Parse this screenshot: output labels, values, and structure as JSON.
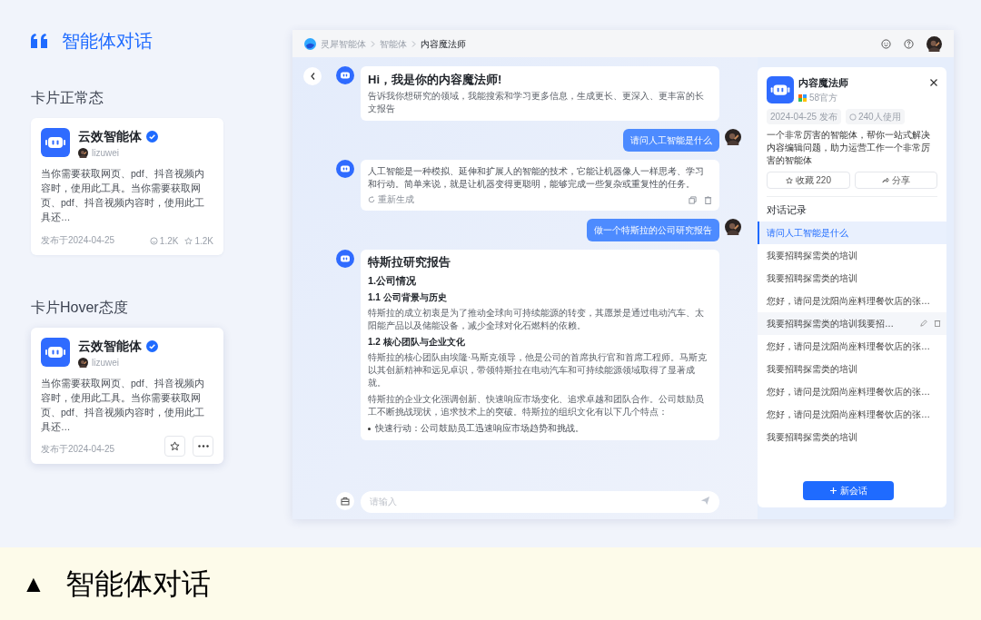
{
  "header": {
    "title": "智能体对话"
  },
  "sections": [
    {
      "heading": "卡片正常态",
      "hover": false,
      "card": {
        "name": "云效智能体",
        "verified": true,
        "author": "lizuwei",
        "description": "当你需要获取网页、pdf、抖音视频内容时，使用此工具。当你需要获取网页、pdf、抖音视频内容时，使用此工具还…",
        "date": "发布于2024-04-25",
        "comments": "1.2K",
        "stars": "1.2K"
      }
    },
    {
      "heading": "卡片Hover态度",
      "hover": true,
      "card": {
        "name": "云效智能体",
        "verified": true,
        "author": "lizuwei",
        "description": "当你需要获取网页、pdf、抖音视频内容时，使用此工具。当你需要获取网页、pdf、抖音视频内容时，使用此工具还…",
        "date": "发布于2024-04-25"
      }
    }
  ],
  "app": {
    "breadcrumb": [
      {
        "label": "灵犀智能体",
        "current": false
      },
      {
        "label": "智能体",
        "current": false
      },
      {
        "label": "内容魔法师",
        "current": true
      }
    ],
    "messages": [
      {
        "kind": "greeting",
        "title": "Hi，我是你的内容魔法师!",
        "text": "告诉我你想研究的领域，我能搜索和学习更多信息，生成更长、更深入、更丰富的长文报告"
      },
      {
        "kind": "user",
        "text": "请问人工智能是什么"
      },
      {
        "kind": "answer",
        "text": "人工智能是一种模拟、延伸和扩展人的智能的技术，它能让机器像人一样思考、学习和行动。简单来说，就是让机器变得更聪明，能够完成一些复杂或重复性的任务。",
        "action": "重新生成"
      },
      {
        "kind": "user",
        "text": "做一个特斯拉的公司研究报告"
      },
      {
        "kind": "report",
        "blocks": [
          {
            "kind": "h1",
            "text": "特斯拉研究报告"
          },
          {
            "kind": "h2",
            "text": "1.公司情况"
          },
          {
            "kind": "h3",
            "text": "1.1 公司背景与历史"
          },
          {
            "kind": "p",
            "text": "特斯拉的成立初衷是为了推动全球向可持续能源的转变，其愿景是通过电动汽车、太阳能产品以及储能设备，减少全球对化石燃料的依赖。"
          },
          {
            "kind": "h3",
            "text": "1.2 核心团队与企业文化"
          },
          {
            "kind": "p",
            "text": "特斯拉的核心团队由埃隆·马斯克领导，他是公司的首席执行官和首席工程师。马斯克以其创新精神和远见卓识，带领特斯拉在电动汽车和可持续能源领域取得了显著成就。"
          },
          {
            "kind": "p",
            "text": "特斯拉的企业文化强调创新、快速响应市场变化、追求卓越和团队合作。公司鼓励员工不断挑战现状，追求技术上的突破。特斯拉的组织文化有以下几个特点："
          },
          {
            "kind": "bullet",
            "text": "快速行动：公司鼓励员工迅速响应市场趋势和挑战。"
          }
        ]
      }
    ],
    "input": {
      "placeholder": "请输入"
    },
    "panel": {
      "name": "内容魔法师",
      "source": "58官方",
      "date_tag": "2024-04-25 发布",
      "usage_tag": "240人使用",
      "description": "一个非常厉害的智能体，帮你一站式解决内容编辑问题，助力运营工作一个非常厉害的智能体",
      "favorite": "收藏 220",
      "share": "分享",
      "history_title": "对话记录",
      "history": [
        {
          "text": "请问人工智能是什么",
          "selected": true,
          "hovered": false
        },
        {
          "text": "我要招聘探需类的培训",
          "selected": false,
          "hovered": false
        },
        {
          "text": "我要招聘探需类的培训",
          "selected": false,
          "hovered": false
        },
        {
          "text": "您好，请问是沈阳尚座料理餐饮店的张…",
          "selected": false,
          "hovered": false
        },
        {
          "text": "我要招聘探需类的培训我要招…",
          "selected": false,
          "hovered": true
        },
        {
          "text": "您好，请问是沈阳尚座料理餐饮店的张…",
          "selected": false,
          "hovered": false
        },
        {
          "text": "我要招聘探需类的培训",
          "selected": false,
          "hovered": false
        },
        {
          "text": "您好，请问是沈阳尚座料理餐饮店的张…",
          "selected": false,
          "hovered": false
        },
        {
          "text": "您好，请问是沈阳尚座料理餐饮店的张…",
          "selected": false,
          "hovered": false
        },
        {
          "text": "我要招聘探需类的培训",
          "selected": false,
          "hovered": false
        }
      ],
      "new_chat": "新会话"
    }
  },
  "caption": {
    "mark": "▲",
    "title": "智能体对话"
  }
}
